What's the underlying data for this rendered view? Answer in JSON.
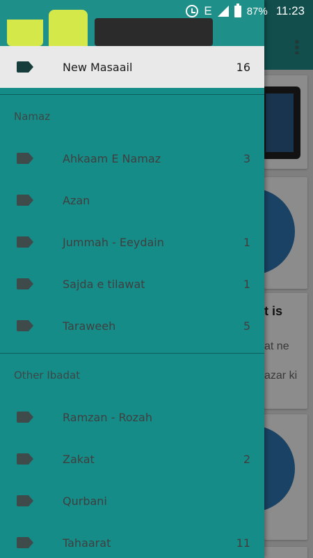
{
  "status_bar": {
    "network": "E",
    "battery": "87%",
    "time": "11:23"
  },
  "drawer": {
    "top_item": {
      "label": "New Masaail",
      "count": "16"
    },
    "sections": [
      {
        "header": "Namaz",
        "items": [
          {
            "label": "Ahkaam E Namaz",
            "count": "3"
          },
          {
            "label": "Azan",
            "count": ""
          },
          {
            "label": "Jummah - Eeydain",
            "count": "1"
          },
          {
            "label": "Sajda e tilawat",
            "count": "1"
          },
          {
            "label": "Taraweeh",
            "count": "5"
          }
        ]
      },
      {
        "header": "Other Ibadat",
        "items": [
          {
            "label": "Ramzan - Rozah",
            "count": ""
          },
          {
            "label": "Zakat",
            "count": "2"
          },
          {
            "label": "Qurbani",
            "count": ""
          },
          {
            "label": "Tahaarat",
            "count": "11"
          }
        ]
      }
    ]
  },
  "background_content": {
    "card_title_fragment": "t is",
    "line1_fragment": "at ne",
    "line2_fragment": "azar ki"
  },
  "colors": {
    "drawer_bg": "#168c88",
    "selected_bg": "#e9e9e9",
    "tag_icon": "#3f4a4a",
    "selected_tag_icon": "#163d3b"
  }
}
